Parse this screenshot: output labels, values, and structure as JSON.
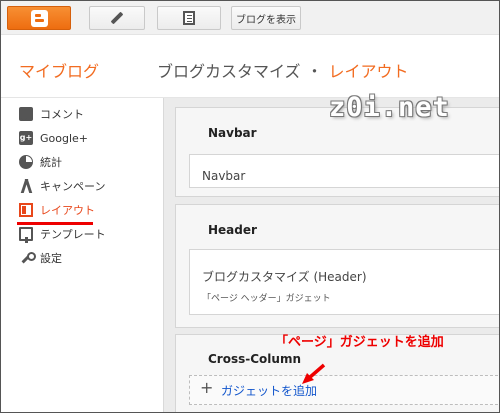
{
  "toolbar": {
    "blogger_icon": "blogger-logo-icon",
    "edit_icon": "pencil-icon",
    "pages_icon": "pages-icon",
    "view_blog_label": "ブログを表示"
  },
  "header": {
    "my_blog": "マイブログ",
    "breadcrumb_parent": "ブログカスタマイズ",
    "breadcrumb_separator": "・",
    "breadcrumb_current": "レイアウト"
  },
  "sidebar": {
    "items": [
      {
        "label": "コメント",
        "icon": "comment-icon"
      },
      {
        "label": "Google+",
        "icon": "google-plus-icon"
      },
      {
        "label": "統計",
        "icon": "stats-pie-icon"
      },
      {
        "label": "キャンペーン",
        "icon": "campaign-icon"
      },
      {
        "label": "レイアウト",
        "icon": "layout-icon",
        "active": true
      },
      {
        "label": "テンプレート",
        "icon": "template-icon"
      },
      {
        "label": "設定",
        "icon": "wrench-icon"
      }
    ]
  },
  "main": {
    "sections": [
      {
        "title": "Navbar",
        "gadget_title": "Navbar"
      },
      {
        "title": "Header",
        "gadget_title": "ブログカスタマイズ (Header)",
        "gadget_sub": "「ページ ヘッダー」ガジェット"
      },
      {
        "title": "Cross-Column",
        "add_label": "ガジェットを追加"
      }
    ]
  },
  "watermark": "z0i.net",
  "annotation": "「ページ」ガジェットを追加",
  "colors": {
    "accent": "#f26c21",
    "annotation_red": "#e00000",
    "link_blue": "#1155cc"
  }
}
